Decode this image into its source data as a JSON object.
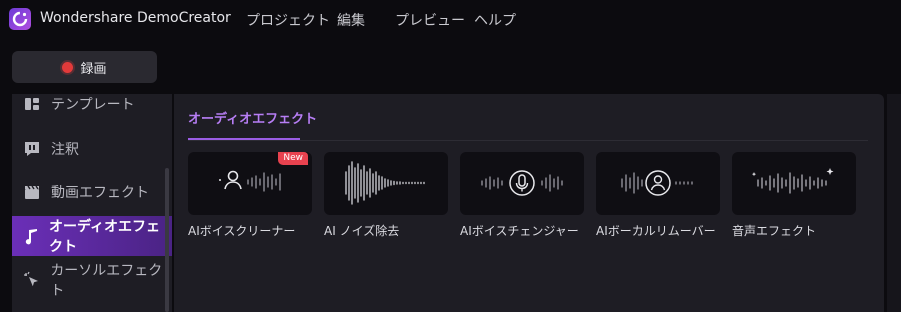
{
  "app": {
    "name": "Wondershare DemoCreator"
  },
  "menu": [
    {
      "label": "プロジェクト"
    },
    {
      "label": "編集"
    },
    {
      "label": "プレビュー"
    },
    {
      "label": "ヘルプ"
    }
  ],
  "record_button": {
    "label": "録画",
    "icon": "record-dot-icon",
    "dot_color": "#e33a3a"
  },
  "sidebar": {
    "items": [
      {
        "label": "テンプレート",
        "icon": "template-icon"
      },
      {
        "label": "注釈",
        "icon": "annotation-icon"
      },
      {
        "label": "動画エフェクト",
        "icon": "clapperboard-icon"
      },
      {
        "label": "オーディオエフェクト",
        "icon": "music-note-icon",
        "active": true
      },
      {
        "label": "カーソルエフェクト",
        "icon": "cursor-click-icon"
      }
    ]
  },
  "panel": {
    "tab": "オーディオエフェクト",
    "accent": "#9b5de5",
    "cards": [
      {
        "label": "AIボイスクリーナー",
        "icon": "voice-cleaner-icon",
        "badge": "New"
      },
      {
        "label": "AI ノイズ除去",
        "icon": "denoise-waveform-icon"
      },
      {
        "label": "AIボイスチェンジャー",
        "icon": "voice-changer-icon"
      },
      {
        "label": "AIボーカルリムーバー",
        "icon": "vocal-remover-icon"
      },
      {
        "label": "音声エフェクト",
        "icon": "sound-effect-icon"
      }
    ]
  }
}
